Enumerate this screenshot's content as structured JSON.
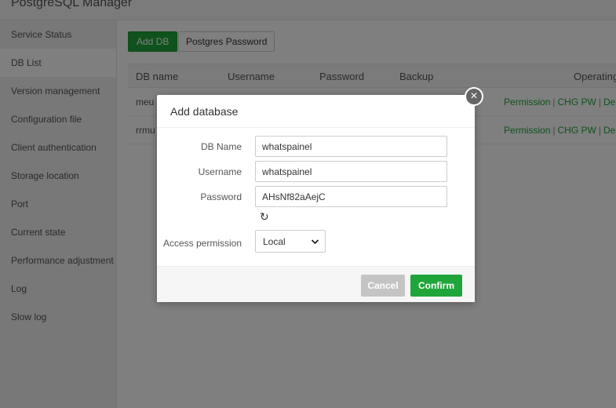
{
  "app": {
    "title": "PostgreSQL Manager"
  },
  "sidebar": {
    "items": [
      {
        "label": "Service Status"
      },
      {
        "label": "DB List"
      },
      {
        "label": "Version management"
      },
      {
        "label": "Configuration file"
      },
      {
        "label": "Client authentication"
      },
      {
        "label": "Storage location"
      },
      {
        "label": "Port"
      },
      {
        "label": "Current state"
      },
      {
        "label": "Performance adjustment"
      },
      {
        "label": "Log"
      },
      {
        "label": "Slow log"
      }
    ],
    "active_index": 1
  },
  "toolbar": {
    "add_db_label": "Add DB",
    "pg_password_label": "Postgres Password"
  },
  "table": {
    "columns": [
      "DB name",
      "Username",
      "Password",
      "Backup",
      "Operating"
    ],
    "rows": [
      {
        "db_name": "meu"
      },
      {
        "db_name": "rrmu"
      }
    ],
    "ops": {
      "permission": "Permission",
      "chg_pw": "CHG PW",
      "del": "Del",
      "sep": "|"
    }
  },
  "modal": {
    "title": "Add database",
    "fields": {
      "db_name": {
        "label": "DB Name",
        "value": "whatspainel"
      },
      "username": {
        "label": "Username",
        "value": "whatspainel"
      },
      "password": {
        "label": "Password",
        "value": "AHsNf82aAejC"
      }
    },
    "access": {
      "label": "Access permission",
      "selected": "Local"
    },
    "cancel_label": "Cancel",
    "confirm_label": "Confirm",
    "close_glyph": "×",
    "refresh_glyph": "↻"
  },
  "colors": {
    "accent": "#20a53a",
    "cancel": "#c4c4c4"
  },
  "icons": {
    "close": "close-icon",
    "refresh": "refresh-icon",
    "chevron": "chevron-down-icon"
  }
}
